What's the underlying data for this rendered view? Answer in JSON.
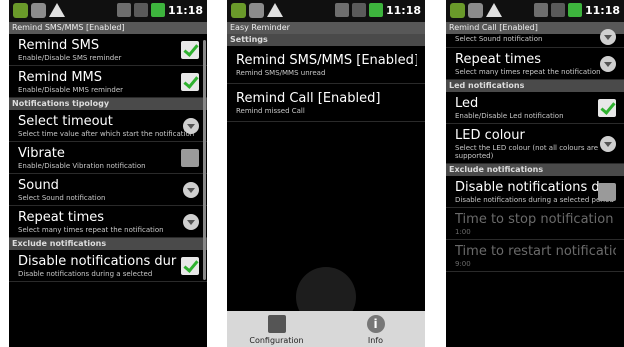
{
  "status": {
    "time": "11:18"
  },
  "p1": {
    "title": "Remind SMS/MMS [Enabled]",
    "items": [
      {
        "title": "Remind SMS",
        "sub": "Enable/Disable SMS reminder"
      },
      {
        "title": "Remind MMS",
        "sub": "Enable/Disable MMS reminder"
      }
    ],
    "cat1": "Notifications tipology",
    "items2": [
      {
        "title": "Select timeout",
        "sub": "Select time value after which start the notification"
      },
      {
        "title": "Vibrate",
        "sub": "Enable/Disable Vibration notification"
      },
      {
        "title": "Sound",
        "sub": "Select Sound notification"
      },
      {
        "title": "Repeat times",
        "sub": "Select many times repeat the notification"
      }
    ],
    "cat2": "Exclude notifications",
    "items3": [
      {
        "title": "Disable notifications dur",
        "sub": "Disable notifications during a selected"
      }
    ]
  },
  "p2": {
    "title": "Easy Reminder",
    "cat": "Settings",
    "items": [
      {
        "title": "Remind SMS/MMS [Enabled]",
        "sub": "Remind SMS/MMS unread"
      },
      {
        "title": "Remind Call [Enabled]",
        "sub": "Remind missed Call"
      }
    ],
    "tabs": [
      {
        "label": "Configuration",
        "icon": "tools-icon"
      },
      {
        "label": "Info",
        "icon": "info-icon"
      }
    ]
  },
  "p3": {
    "title": "Remind Call [Enabled]",
    "top_sub": "Select Sound notification",
    "items": [
      {
        "title": "Repeat times",
        "sub": "Select many times repeat the notification"
      }
    ],
    "cat1": "Led notifications",
    "items2": [
      {
        "title": "Led",
        "sub": "Enable/Disable Led notification"
      },
      {
        "title": "LED colour",
        "sub": "Select the LED colour (not all colours are supported)"
      }
    ],
    "cat2": "Exclude notifications",
    "items3": [
      {
        "title": "Disable notifications dur",
        "sub": "Disable notifications during a selected period"
      },
      {
        "title": "Time to stop notification",
        "sub": "1:00"
      },
      {
        "title": "Time to restart notification",
        "sub": "9:00"
      }
    ]
  },
  "colors": {
    "check": "#2fb12f",
    "category": "#4a4a4a",
    "title": "#585858"
  }
}
